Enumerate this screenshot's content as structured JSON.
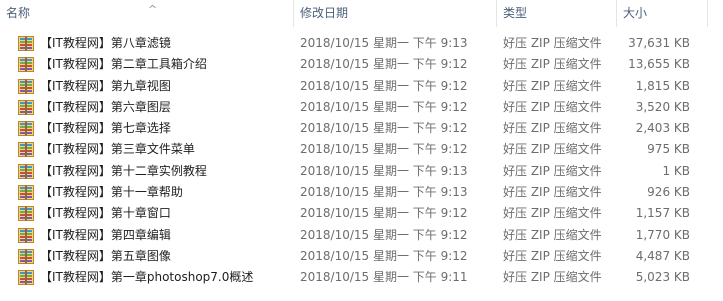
{
  "columns": {
    "name": "名称",
    "date": "修改日期",
    "type": "类型",
    "size": "大小"
  },
  "rows": [
    {
      "name": "【IT教程网】第八章滤镜",
      "date": "2018/10/15 星期一 下午 9:13",
      "type": "好压 ZIP 压缩文件",
      "size": "37,631 KB"
    },
    {
      "name": "【IT教程网】第二章工具箱介绍",
      "date": "2018/10/15 星期一 下午 9:12",
      "type": "好压 ZIP 压缩文件",
      "size": "13,655 KB"
    },
    {
      "name": "【IT教程网】第九章视图",
      "date": "2018/10/15 星期一 下午 9:12",
      "type": "好压 ZIP 压缩文件",
      "size": "1,815 KB"
    },
    {
      "name": "【IT教程网】第六章图层",
      "date": "2018/10/15 星期一 下午 9:12",
      "type": "好压 ZIP 压缩文件",
      "size": "3,520 KB"
    },
    {
      "name": "【IT教程网】第七章选择",
      "date": "2018/10/15 星期一 下午 9:12",
      "type": "好压 ZIP 压缩文件",
      "size": "2,403 KB"
    },
    {
      "name": "【IT教程网】第三章文件菜单",
      "date": "2018/10/15 星期一 下午 9:12",
      "type": "好压 ZIP 压缩文件",
      "size": "975 KB"
    },
    {
      "name": "【IT教程网】第十二章实例教程",
      "date": "2018/10/15 星期一 下午 9:13",
      "type": "好压 ZIP 压缩文件",
      "size": "1 KB"
    },
    {
      "name": "【IT教程网】第十一章帮助",
      "date": "2018/10/15 星期一 下午 9:13",
      "type": "好压 ZIP 压缩文件",
      "size": "926 KB"
    },
    {
      "name": "【IT教程网】第十章窗口",
      "date": "2018/10/15 星期一 下午 9:12",
      "type": "好压 ZIP 压缩文件",
      "size": "1,157 KB"
    },
    {
      "name": "【IT教程网】第四章编辑",
      "date": "2018/10/15 星期一 下午 9:12",
      "type": "好压 ZIP 压缩文件",
      "size": "1,770 KB"
    },
    {
      "name": "【IT教程网】第五章图像",
      "date": "2018/10/15 星期一 下午 9:12",
      "type": "好压 ZIP 压缩文件",
      "size": "4,487 KB"
    },
    {
      "name": "【IT教程网】第一章photoshop7.0概述",
      "date": "2018/10/15 星期一 下午 9:11",
      "type": "好压 ZIP 压缩文件",
      "size": "5,023 KB"
    }
  ],
  "icons": {
    "file_icon": "zip-archive-icon",
    "sort_indicator": "sort-ascending-caret-icon"
  },
  "colors": {
    "header_text": "#4c607a",
    "name_text": "#1e1e1e",
    "detail_text": "#6d6d6d"
  }
}
